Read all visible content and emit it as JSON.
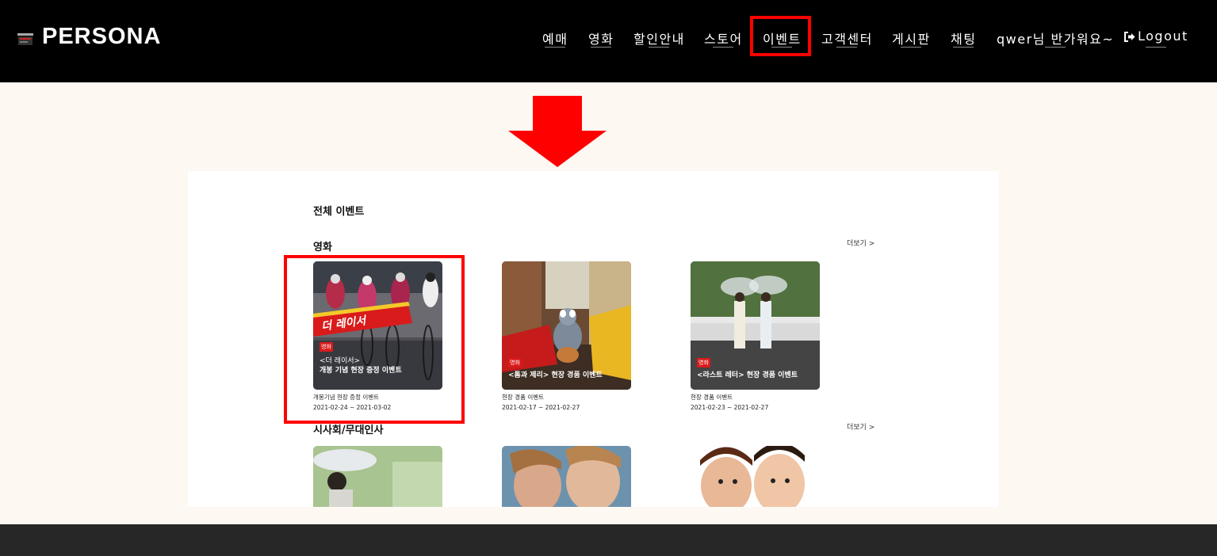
{
  "header": {
    "logo": "PERSONA",
    "nav": [
      {
        "label": "예매"
      },
      {
        "label": "영화"
      },
      {
        "label": "할인안내"
      },
      {
        "label": "스토어"
      },
      {
        "label": "이벤트"
      },
      {
        "label": "고객센터"
      },
      {
        "label": "게시판"
      },
      {
        "label": "채팅"
      },
      {
        "label": "qwer님 반가워요~"
      },
      {
        "label": "Logout"
      }
    ]
  },
  "events": {
    "title": "전체 이벤트",
    "more_label": "더보기 >",
    "categories": [
      {
        "name": "영화",
        "cards": [
          {
            "title": "개봉기념 현장 증정 이벤트",
            "date": "2021-02-24 ~ 2021-03-02",
            "poster_tag": "영화",
            "poster_line1": "<더 레이서>",
            "poster_line2": "개봉 기념 현장 증정 이벤트",
            "poster_logo": "더 레이서"
          },
          {
            "title": "현장 경품 이벤트",
            "date": "2021-02-17 ~ 2021-02-27",
            "poster_tag": "영화",
            "poster_line1": "<톰과 제리> 현장 경품 이벤트"
          },
          {
            "title": "현장 경품 이벤트",
            "date": "2021-02-23 ~ 2021-02-27",
            "poster_tag": "영화",
            "poster_line1": "<라스트 레터> 현장 경품 이벤트"
          }
        ]
      },
      {
        "name": "시사회/무대인사",
        "cards": [
          {},
          {},
          {}
        ]
      }
    ]
  },
  "colors": {
    "highlight": "#ff0000",
    "header_bg": "#000000",
    "page_bg": "#fdf8f2",
    "footer_bg": "#272727"
  }
}
